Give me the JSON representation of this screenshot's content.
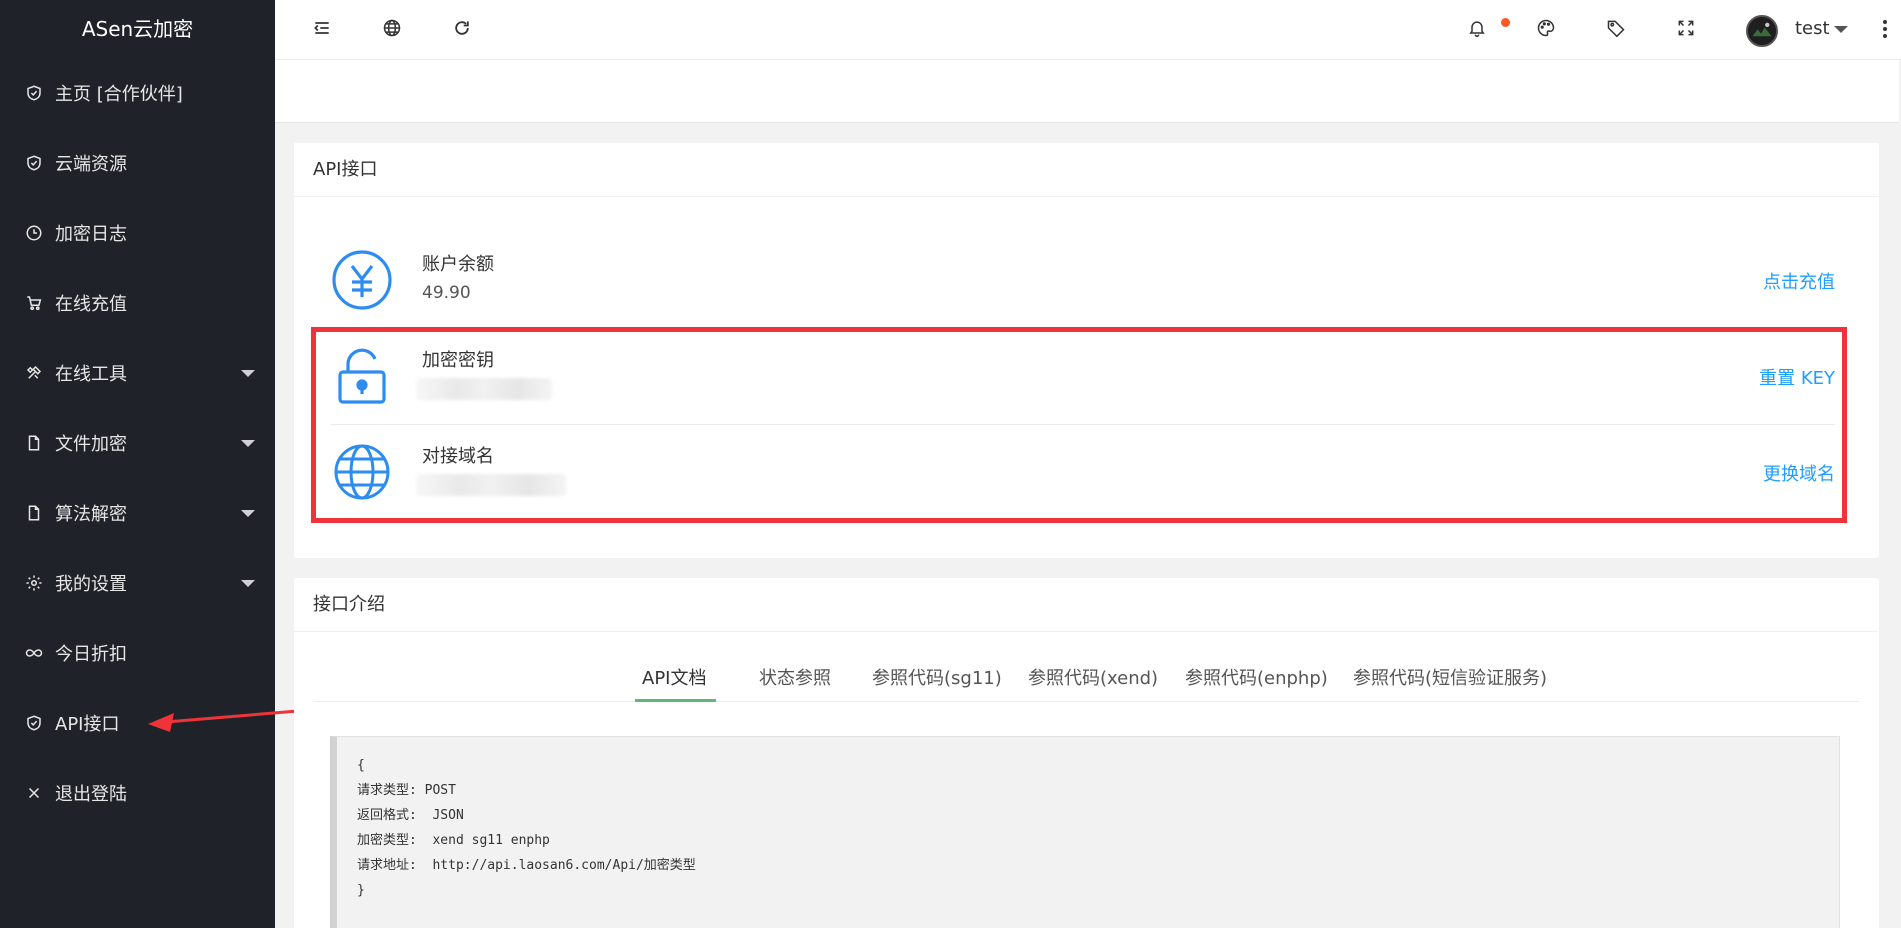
{
  "app": {
    "title": "ASen云加密"
  },
  "sidebar": {
    "items": [
      {
        "label": "主页 [合作伙伴]",
        "icon": "shield-check-icon",
        "has_submenu": false
      },
      {
        "label": "云端资源",
        "icon": "shield-check-icon",
        "has_submenu": false
      },
      {
        "label": "加密日志",
        "icon": "clock-icon",
        "has_submenu": false
      },
      {
        "label": "在线充值",
        "icon": "cart-icon",
        "has_submenu": false
      },
      {
        "label": "在线工具",
        "icon": "tools-icon",
        "has_submenu": true
      },
      {
        "label": "文件加密",
        "icon": "file-icon",
        "has_submenu": true
      },
      {
        "label": "算法解密",
        "icon": "file-icon",
        "has_submenu": true
      },
      {
        "label": "我的设置",
        "icon": "gear-icon",
        "has_submenu": true
      },
      {
        "label": "今日折扣",
        "icon": "infinity-icon",
        "has_submenu": false
      },
      {
        "label": "API接口",
        "icon": "shield-check-icon",
        "has_submenu": false
      },
      {
        "label": "退出登陆",
        "icon": "close-icon",
        "has_submenu": false
      }
    ]
  },
  "header": {
    "username": "test",
    "icons": [
      "menu-collapse-icon",
      "globe-icon",
      "refresh-icon",
      "bell-icon",
      "palette-icon",
      "tag-icon",
      "fullscreen-icon",
      "more-vertical-icon"
    ]
  },
  "api_card": {
    "title": "API接口",
    "rows": [
      {
        "label": "账户余额",
        "value": "49.90",
        "action": "点击充值",
        "icon": "yen-icon"
      },
      {
        "label": "加密密钥",
        "value": "",
        "action": "重置 KEY",
        "icon": "unlock-icon"
      },
      {
        "label": "对接域名",
        "value": "",
        "action": "更换域名",
        "icon": "globe-icon"
      }
    ]
  },
  "intro_card": {
    "title": "接口介绍",
    "tabs": [
      "API文档",
      "状态参照",
      "参照代码(sg11)",
      "参照代码(xend)",
      "参照代码(enphp)",
      "参照代码(短信验证服务)"
    ],
    "active_tab": "API文档",
    "code_lines": [
      "{",
      "请求类型: POST",
      "返回格式:  JSON",
      "加密类型:  xend sg11 enphp",
      "请求地址:  http://api.laosan6.com/Api/加密类型",
      "}"
    ]
  },
  "colors": {
    "sidebar_bg": "#20222a",
    "link": "#1e9fff",
    "icon_blue": "#2d8cf0",
    "highlight_red": "#ee3339",
    "tab_active": "#5fb878",
    "badge": "#ff5722"
  }
}
